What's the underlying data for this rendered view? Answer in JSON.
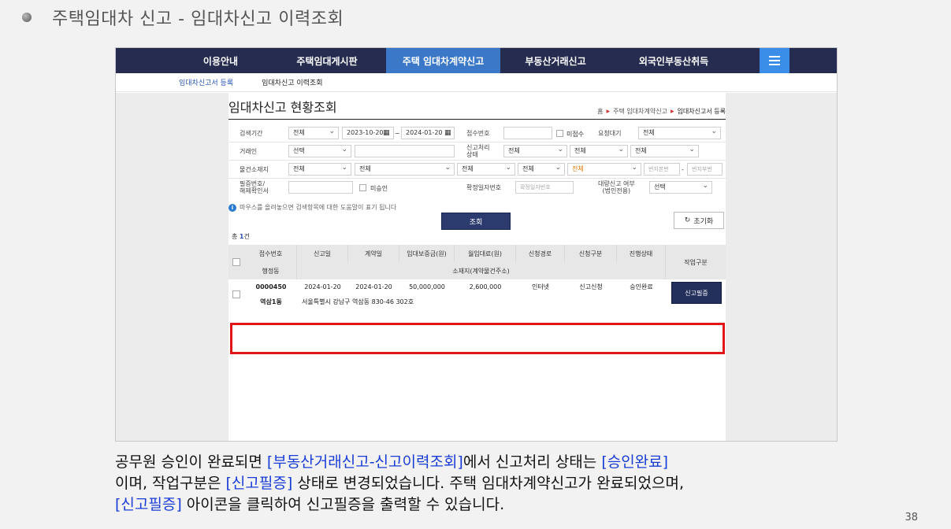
{
  "slide": {
    "title": "주택임대차 신고 - 임대차신고 이력조회",
    "page_number": "38",
    "description": {
      "p1": "공무원 승인이 완료되면 ",
      "h1": "[부동산거래신고-신고이력조회]",
      "p2": "에서 신고처리 상태는 ",
      "h2": "[승인완료]",
      "p3": "이며, 작업구분은 ",
      "h3": "[신고필증]",
      "p4": " 상태로 변경되었습니다. 주택 임대차계약신고가 완료되었으며, ",
      "h4": "[신고필증]",
      "p5": " 아이콘을 클릭하여 신고필증을 출력할 수 있습니다."
    }
  },
  "nav": {
    "items": [
      "이용안내",
      "주택임대게시판",
      "주택 임대차계약신고",
      "부동산거래신고",
      "외국인부동산취득"
    ],
    "active_index": 2,
    "menu_icon": "hamburger-menu-icon"
  },
  "subnav": {
    "items": [
      "임대차신고서 등록",
      "임대차신고 이력조회"
    ]
  },
  "page": {
    "title": "임대차신고 현황조회",
    "breadcrumb": [
      "홈",
      "주택 임대차계약신고",
      "임대차신고서 등록"
    ]
  },
  "search": {
    "period_label": "검색기간",
    "period_select": "전체",
    "date_from": "2023-10-20",
    "date_sep": "~",
    "date_to": "2024-01-20",
    "receipt_no_label": "접수번호",
    "receipt_no_value": "",
    "unreceived_label": "미접수",
    "request_label": "요청대기",
    "request_select": "전체",
    "party_label": "거래인",
    "party_select": "선택",
    "party_input": "",
    "status_label": "신고처리\n상태",
    "status_select1": "전체",
    "status_select2": "전체",
    "status_select3": "전체",
    "location_label": "물건소재지",
    "loc_select1": "전체",
    "loc_select2": "전체",
    "loc_select3": "전체",
    "loc_select4": "전체",
    "loc_select5": "전체",
    "lot_main_placeholder": "번지본번",
    "lot_sep": "-",
    "lot_sub_placeholder": "번지부번",
    "cert_label": "필증번호/\n해제확인서",
    "cert_input": "",
    "unapproved_label": "미승인",
    "confirm_date_label": "확정일자번호",
    "confirm_date_placeholder": "확정일자번호",
    "agent_label": "대량신고 여부\n(법인전용)",
    "agent_select": "선택",
    "hint": "마우스를 올려놓으면 검색항목에 대한 도움말이 표기 됩니다",
    "search_button": "조회",
    "reset_button": "초기화"
  },
  "results": {
    "total_prefix": "총 ",
    "total_count": "1",
    "total_suffix": "건",
    "headers_row1": [
      "접수번호",
      "신고일",
      "계약일",
      "임대보증금(원)",
      "월임대료(원)",
      "신청경로",
      "신청구분",
      "진행상태"
    ],
    "header_work": "작업구분",
    "headers_row2_left": "행정동",
    "headers_row2_right": "소재지(계약물건주소)",
    "rows": [
      {
        "receipt_no": "0000450",
        "report_date": "2024-01-20",
        "contract_date": "2024-01-20",
        "deposit": "50,000,000",
        "monthly_rent": "2,600,000",
        "channel": "인터넷",
        "type": "신고신청",
        "status": "승인완료",
        "action": "신고필증",
        "dong": "역삼1동",
        "address": "서울특별시 강남구 역삼동 830-46 302호"
      }
    ]
  }
}
